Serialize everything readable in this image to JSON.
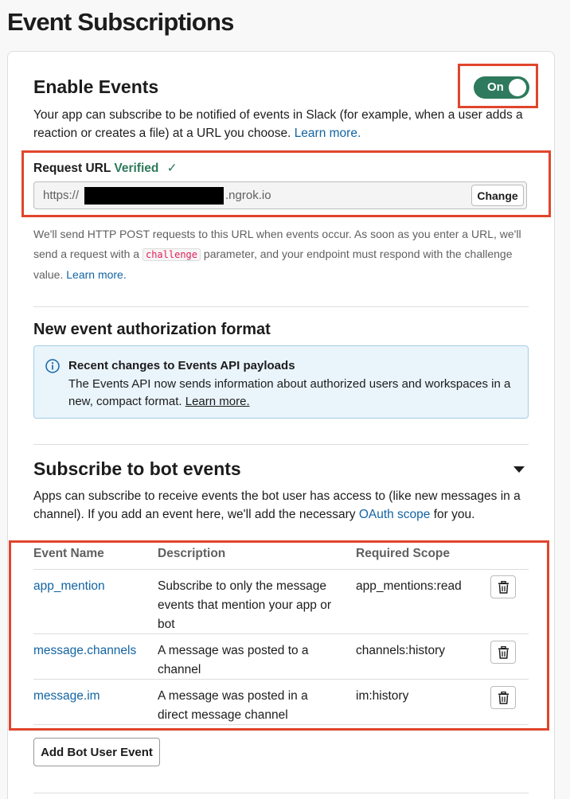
{
  "page": {
    "title": "Event Subscriptions"
  },
  "enable_events": {
    "heading": "Enable Events",
    "toggle_label": "On",
    "desc": "Your app can subscribe to be notified of events in Slack (for example, when a user adds a reaction or creates a file) at a URL you choose.",
    "learn_more": "Learn more."
  },
  "request_url": {
    "label": "Request URL",
    "status": "Verified",
    "check": "✓",
    "url_prefix": "https://",
    "url_suffix": ".ngrok.io",
    "change_label": "Change",
    "help_part1": "We'll send HTTP POST requests to this URL when events occur. As soon as you enter a URL, we'll send a request with a",
    "help_code": "challenge",
    "help_part2": "parameter, and your endpoint must respond with the challenge value.",
    "learn_more": "Learn more."
  },
  "auth_format": {
    "heading": "New event authorization format",
    "info_title": "Recent changes to Events API payloads",
    "info_body": "The Events API now sends information about authorized users and workspaces in a new, compact format.",
    "learn_more": "Learn more."
  },
  "bot_events": {
    "heading": "Subscribe to bot events",
    "desc_part1": "Apps can subscribe to receive events the bot user has access to (like new messages in a channel). If you add an event here, we'll add the necessary",
    "oauth_link": "OAuth scope",
    "desc_part2": "for you.",
    "columns": [
      "Event Name",
      "Description",
      "Required Scope"
    ],
    "rows": [
      {
        "name": "app_mention",
        "description": "Subscribe to only the message events that mention your app or bot",
        "scope": "app_mentions:read"
      },
      {
        "name": "message.channels",
        "description": "A message was posted to a channel",
        "scope": "channels:history"
      },
      {
        "name": "message.im",
        "description": "A message was posted in a direct message channel",
        "scope": "im:history"
      }
    ],
    "add_button": "Add Bot User Event"
  },
  "colors": {
    "accent_green": "#2d7a5c",
    "link_blue": "#1264a3",
    "highlight_red": "#e0452c"
  }
}
